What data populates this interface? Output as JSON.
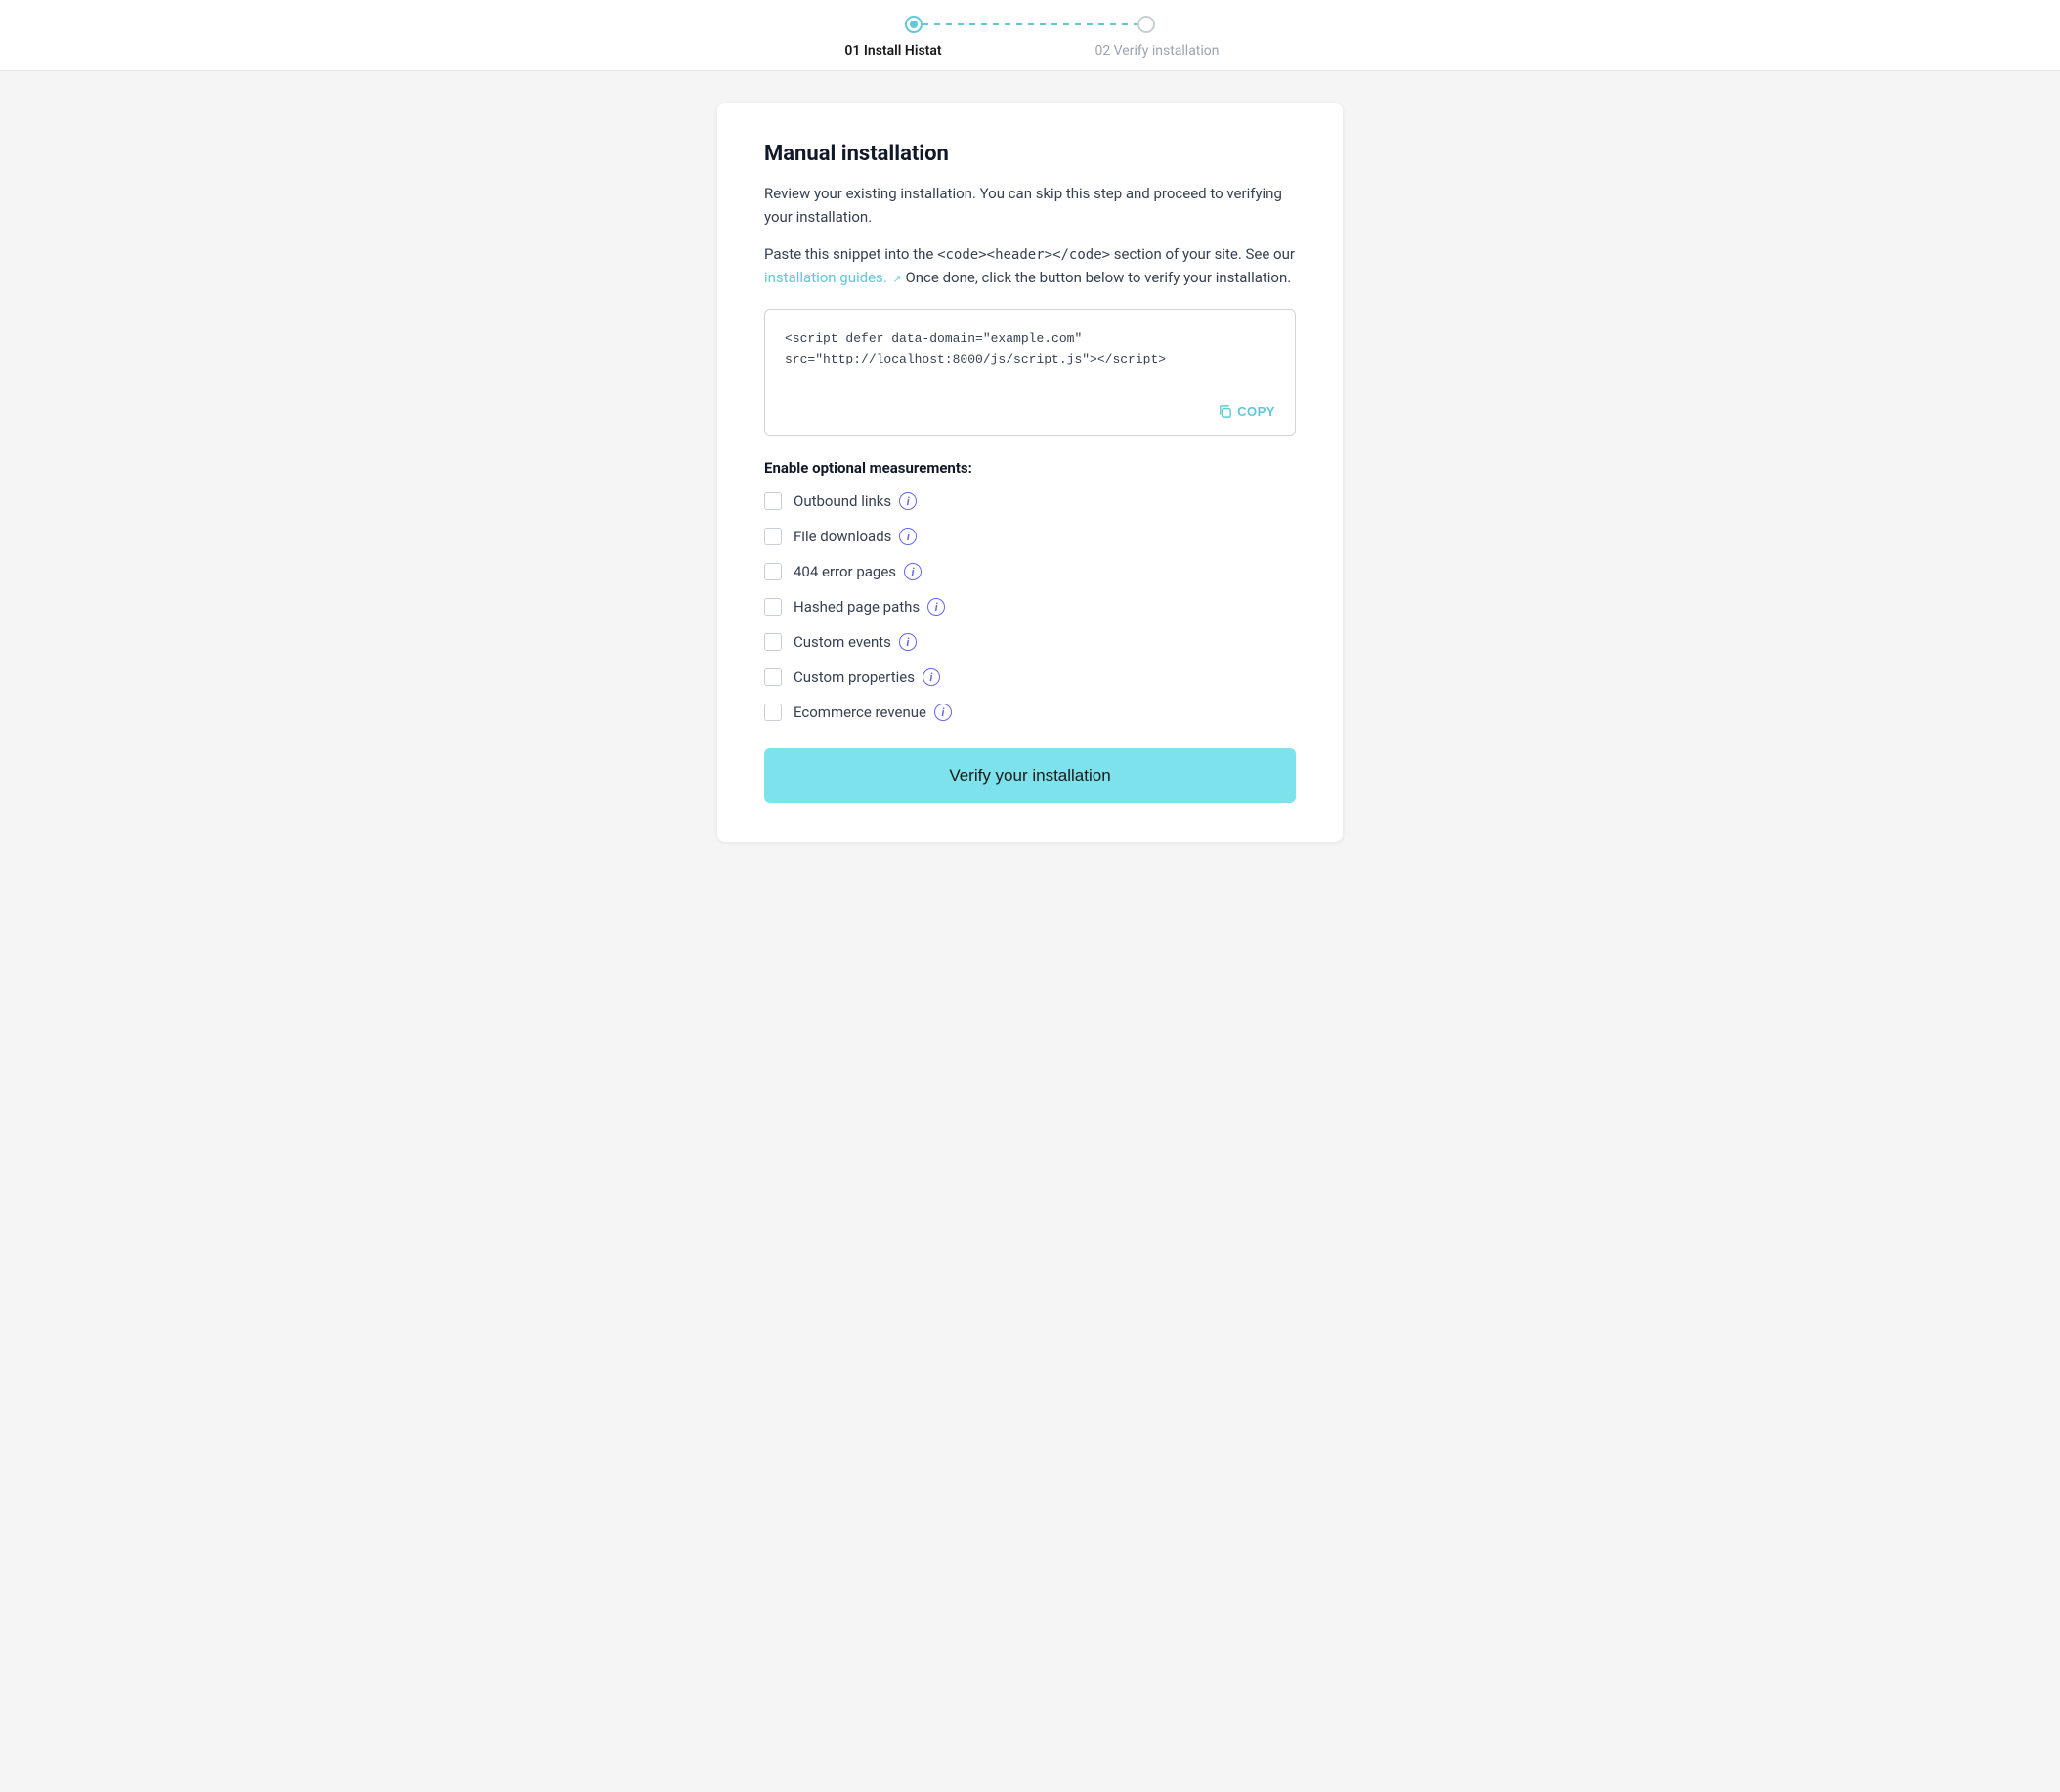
{
  "stepper": {
    "step1": {
      "label": "01 Install Histat",
      "active": true
    },
    "step2": {
      "label": "02 Verify installation",
      "active": false
    }
  },
  "main": {
    "title": "Manual installation",
    "intro1": "Review your existing installation. You can skip this step and proceed to verifying your installation.",
    "intro2_before": "Paste this snippet into the ",
    "intro2_code": "<code><header></code>",
    "intro2_after": " section of your site. See our ",
    "intro2_link": "installation guides.",
    "intro2_end": " Once done, click the button below to verify your installation.",
    "code_snippet": "<script defer data-domain=\"example.com\"\nsrc=\"http://localhost:8000/js/script.js\"></script>",
    "copy_label": "COPY",
    "measurements_title": "Enable optional measurements:",
    "measurements": [
      {
        "id": "outbound",
        "label": "Outbound links",
        "checked": false
      },
      {
        "id": "downloads",
        "label": "File downloads",
        "checked": false
      },
      {
        "id": "404",
        "label": "404 error pages",
        "checked": false
      },
      {
        "id": "hashed",
        "label": "Hashed page paths",
        "checked": false
      },
      {
        "id": "custom-events",
        "label": "Custom events",
        "checked": false
      },
      {
        "id": "custom-props",
        "label": "Custom properties",
        "checked": false
      },
      {
        "id": "ecommerce",
        "label": "Ecommerce revenue",
        "checked": false
      }
    ],
    "verify_button": "Verify your installation"
  }
}
